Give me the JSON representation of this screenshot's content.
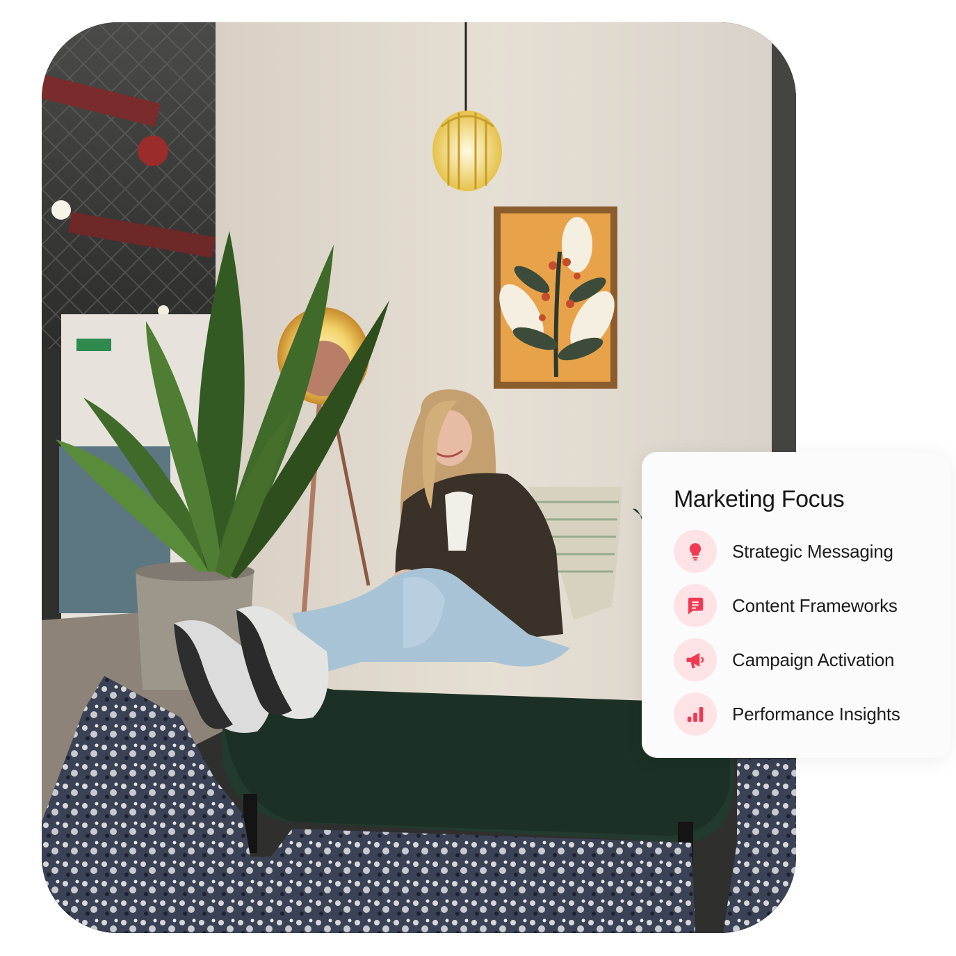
{
  "card": {
    "title": "Marketing Focus",
    "accent_color": "#f03a53",
    "icon_background": "#fde3e6",
    "items": [
      {
        "label": "Strategic Messaging",
        "icon": "lightbulb-icon"
      },
      {
        "label": "Content Frameworks",
        "icon": "message-square-icon"
      },
      {
        "label": "Campaign Activation",
        "icon": "megaphone-icon"
      },
      {
        "label": "Performance Insights",
        "icon": "bar-chart-icon"
      }
    ]
  }
}
